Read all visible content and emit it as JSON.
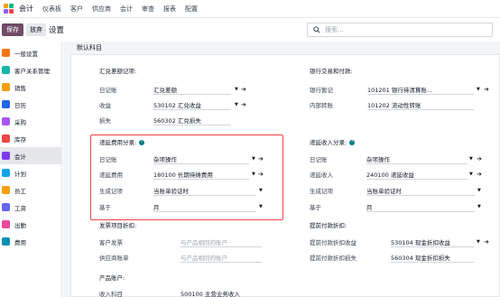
{
  "topbar": {
    "app_title": "会计",
    "menu": [
      "仪表板",
      "客户",
      "供应商",
      "会计",
      "审查",
      "报表",
      "配置"
    ]
  },
  "controls": {
    "save_label": "保存",
    "discard_label": "放弃",
    "page_title": "设置",
    "search_placeholder": "搜索..."
  },
  "sidebar": {
    "items": [
      {
        "label": "一般设置",
        "icon": "settings-icon",
        "color": "#f97316"
      },
      {
        "label": "客户关系管理",
        "icon": "crm-icon",
        "color": "#14b8a6"
      },
      {
        "label": "销售",
        "icon": "sales-icon",
        "color": "#f59e0b"
      },
      {
        "label": "日历",
        "icon": "calendar-icon",
        "color": "#2563eb"
      },
      {
        "label": "采购",
        "icon": "purchase-icon",
        "color": "#a855f7"
      },
      {
        "label": "库存",
        "icon": "inventory-icon",
        "color": "#ef4444"
      },
      {
        "label": "会计",
        "icon": "accounting-icon",
        "color": "#7c3aed"
      },
      {
        "label": "计划",
        "icon": "planning-icon",
        "color": "#0ea5e9"
      },
      {
        "label": "员工",
        "icon": "employees-icon",
        "color": "#f59e0b"
      },
      {
        "label": "工资",
        "icon": "payroll-icon",
        "color": "#6366f1"
      },
      {
        "label": "出勤",
        "icon": "attendance-icon",
        "color": "#ec4899"
      },
      {
        "label": "费用",
        "icon": "expenses-icon",
        "color": "#0891b2"
      }
    ],
    "active_index": 6
  },
  "main": {
    "section_title": "默认科目",
    "fx": {
      "title": "汇兑差额记项:",
      "rows": [
        {
          "label": "日记账",
          "value": "汇兑差额"
        },
        {
          "label": "收益",
          "value": "530102 汇兑收益"
        },
        {
          "label": "损失",
          "value": "560302 汇兑损失"
        }
      ]
    },
    "bank": {
      "title": "银行交易和付款:",
      "rows": [
        {
          "label": "银行暂记",
          "value": "101201 银行待清算账..."
        },
        {
          "label": "内部转账",
          "value": "101202 流动性转账"
        }
      ]
    },
    "deferred_exp": {
      "title": "递延费用分录:",
      "rows": [
        {
          "label": "日记账",
          "value": "杂项操作"
        },
        {
          "label": "递延费用",
          "value": "180100 长期待摊费用"
        },
        {
          "label": "生成记项",
          "value": "当账单验证时"
        },
        {
          "label": "基于",
          "value": "月"
        }
      ]
    },
    "deferred_rev": {
      "title": "递延收入分录:",
      "rows": [
        {
          "label": "日记账",
          "value": "杂项操作"
        },
        {
          "label": "递延收入",
          "value": "240100 递延收益"
        },
        {
          "label": "生成记项",
          "value": "当账单验证时"
        },
        {
          "label": "基于",
          "value": "月"
        }
      ]
    },
    "invoice_discount": {
      "title": "发票项目折扣:",
      "rows": [
        {
          "label": "客户发票",
          "value": "与产品相同的账户"
        },
        {
          "label": "供应商账单",
          "value": "与产品相同的账户"
        }
      ]
    },
    "early_pay": {
      "title": "提前付款折扣:",
      "rows": [
        {
          "label": "提前付款折扣收益",
          "value": "530104 现金折扣收益"
        },
        {
          "label": "提前付款折扣损失",
          "value": "560304 现金折扣损失"
        }
      ]
    },
    "product_accounts": {
      "title": "产品账户:",
      "rows": [
        {
          "label": "收入科目",
          "value": "500100 主营业务收入"
        }
      ]
    }
  },
  "colors": {
    "brand": "#714B67",
    "highlight": "#ef4444",
    "help": "#017e84"
  }
}
